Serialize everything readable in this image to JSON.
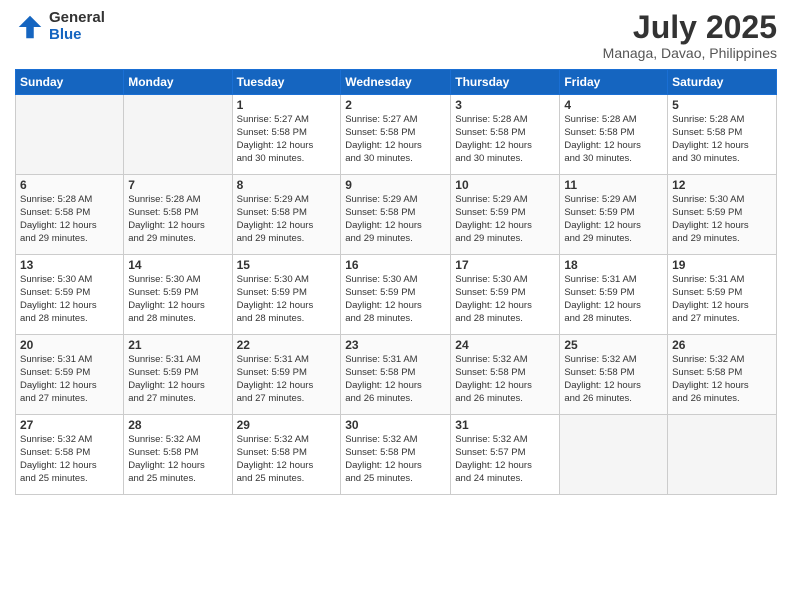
{
  "logo": {
    "general": "General",
    "blue": "Blue"
  },
  "header": {
    "month_year": "July 2025",
    "location": "Managa, Davao, Philippines"
  },
  "days_of_week": [
    "Sunday",
    "Monday",
    "Tuesday",
    "Wednesday",
    "Thursday",
    "Friday",
    "Saturday"
  ],
  "weeks": [
    [
      {
        "day": "",
        "info": ""
      },
      {
        "day": "",
        "info": ""
      },
      {
        "day": "1",
        "info": "Sunrise: 5:27 AM\nSunset: 5:58 PM\nDaylight: 12 hours\nand 30 minutes."
      },
      {
        "day": "2",
        "info": "Sunrise: 5:27 AM\nSunset: 5:58 PM\nDaylight: 12 hours\nand 30 minutes."
      },
      {
        "day": "3",
        "info": "Sunrise: 5:28 AM\nSunset: 5:58 PM\nDaylight: 12 hours\nand 30 minutes."
      },
      {
        "day": "4",
        "info": "Sunrise: 5:28 AM\nSunset: 5:58 PM\nDaylight: 12 hours\nand 30 minutes."
      },
      {
        "day": "5",
        "info": "Sunrise: 5:28 AM\nSunset: 5:58 PM\nDaylight: 12 hours\nand 30 minutes."
      }
    ],
    [
      {
        "day": "6",
        "info": "Sunrise: 5:28 AM\nSunset: 5:58 PM\nDaylight: 12 hours\nand 29 minutes."
      },
      {
        "day": "7",
        "info": "Sunrise: 5:28 AM\nSunset: 5:58 PM\nDaylight: 12 hours\nand 29 minutes."
      },
      {
        "day": "8",
        "info": "Sunrise: 5:29 AM\nSunset: 5:58 PM\nDaylight: 12 hours\nand 29 minutes."
      },
      {
        "day": "9",
        "info": "Sunrise: 5:29 AM\nSunset: 5:58 PM\nDaylight: 12 hours\nand 29 minutes."
      },
      {
        "day": "10",
        "info": "Sunrise: 5:29 AM\nSunset: 5:59 PM\nDaylight: 12 hours\nand 29 minutes."
      },
      {
        "day": "11",
        "info": "Sunrise: 5:29 AM\nSunset: 5:59 PM\nDaylight: 12 hours\nand 29 minutes."
      },
      {
        "day": "12",
        "info": "Sunrise: 5:30 AM\nSunset: 5:59 PM\nDaylight: 12 hours\nand 29 minutes."
      }
    ],
    [
      {
        "day": "13",
        "info": "Sunrise: 5:30 AM\nSunset: 5:59 PM\nDaylight: 12 hours\nand 28 minutes."
      },
      {
        "day": "14",
        "info": "Sunrise: 5:30 AM\nSunset: 5:59 PM\nDaylight: 12 hours\nand 28 minutes."
      },
      {
        "day": "15",
        "info": "Sunrise: 5:30 AM\nSunset: 5:59 PM\nDaylight: 12 hours\nand 28 minutes."
      },
      {
        "day": "16",
        "info": "Sunrise: 5:30 AM\nSunset: 5:59 PM\nDaylight: 12 hours\nand 28 minutes."
      },
      {
        "day": "17",
        "info": "Sunrise: 5:30 AM\nSunset: 5:59 PM\nDaylight: 12 hours\nand 28 minutes."
      },
      {
        "day": "18",
        "info": "Sunrise: 5:31 AM\nSunset: 5:59 PM\nDaylight: 12 hours\nand 28 minutes."
      },
      {
        "day": "19",
        "info": "Sunrise: 5:31 AM\nSunset: 5:59 PM\nDaylight: 12 hours\nand 27 minutes."
      }
    ],
    [
      {
        "day": "20",
        "info": "Sunrise: 5:31 AM\nSunset: 5:59 PM\nDaylight: 12 hours\nand 27 minutes."
      },
      {
        "day": "21",
        "info": "Sunrise: 5:31 AM\nSunset: 5:59 PM\nDaylight: 12 hours\nand 27 minutes."
      },
      {
        "day": "22",
        "info": "Sunrise: 5:31 AM\nSunset: 5:59 PM\nDaylight: 12 hours\nand 27 minutes."
      },
      {
        "day": "23",
        "info": "Sunrise: 5:31 AM\nSunset: 5:58 PM\nDaylight: 12 hours\nand 26 minutes."
      },
      {
        "day": "24",
        "info": "Sunrise: 5:32 AM\nSunset: 5:58 PM\nDaylight: 12 hours\nand 26 minutes."
      },
      {
        "day": "25",
        "info": "Sunrise: 5:32 AM\nSunset: 5:58 PM\nDaylight: 12 hours\nand 26 minutes."
      },
      {
        "day": "26",
        "info": "Sunrise: 5:32 AM\nSunset: 5:58 PM\nDaylight: 12 hours\nand 26 minutes."
      }
    ],
    [
      {
        "day": "27",
        "info": "Sunrise: 5:32 AM\nSunset: 5:58 PM\nDaylight: 12 hours\nand 25 minutes."
      },
      {
        "day": "28",
        "info": "Sunrise: 5:32 AM\nSunset: 5:58 PM\nDaylight: 12 hours\nand 25 minutes."
      },
      {
        "day": "29",
        "info": "Sunrise: 5:32 AM\nSunset: 5:58 PM\nDaylight: 12 hours\nand 25 minutes."
      },
      {
        "day": "30",
        "info": "Sunrise: 5:32 AM\nSunset: 5:58 PM\nDaylight: 12 hours\nand 25 minutes."
      },
      {
        "day": "31",
        "info": "Sunrise: 5:32 AM\nSunset: 5:57 PM\nDaylight: 12 hours\nand 24 minutes."
      },
      {
        "day": "",
        "info": ""
      },
      {
        "day": "",
        "info": ""
      }
    ]
  ]
}
